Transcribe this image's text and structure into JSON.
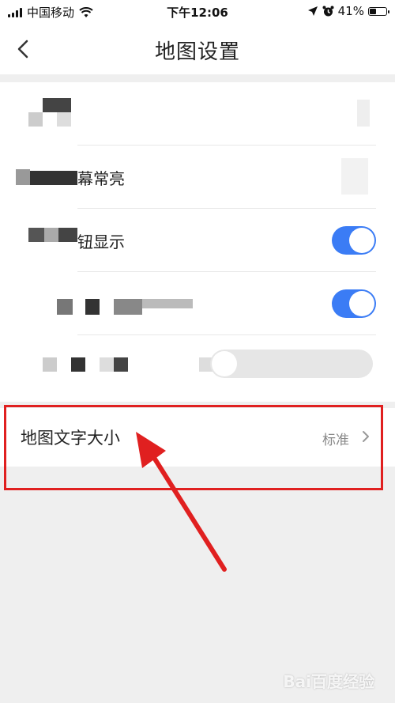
{
  "status_bar": {
    "carrier": "中国移动",
    "time": "下午12:06",
    "battery": "41%",
    "battery_level": 0.41
  },
  "header": {
    "title": "地图设置",
    "back_icon": "chevron-left-icon"
  },
  "settings": {
    "rows": [
      {
        "label": ""
      },
      {
        "label": "幕常亮",
        "toggle": false
      },
      {
        "label": "钮显示",
        "toggle": true
      },
      {
        "label": "",
        "toggle": true
      },
      {
        "label": "",
        "toggle": false
      }
    ]
  },
  "map_text_size": {
    "label": "地图文字大小",
    "value": "标准",
    "icon": "chevron-right-icon"
  },
  "annotation": {
    "color": "#e02020"
  },
  "watermark": {
    "text": "Bai百度经验"
  },
  "colors": {
    "accent": "#3b7cf5",
    "highlight": "#e02020"
  }
}
